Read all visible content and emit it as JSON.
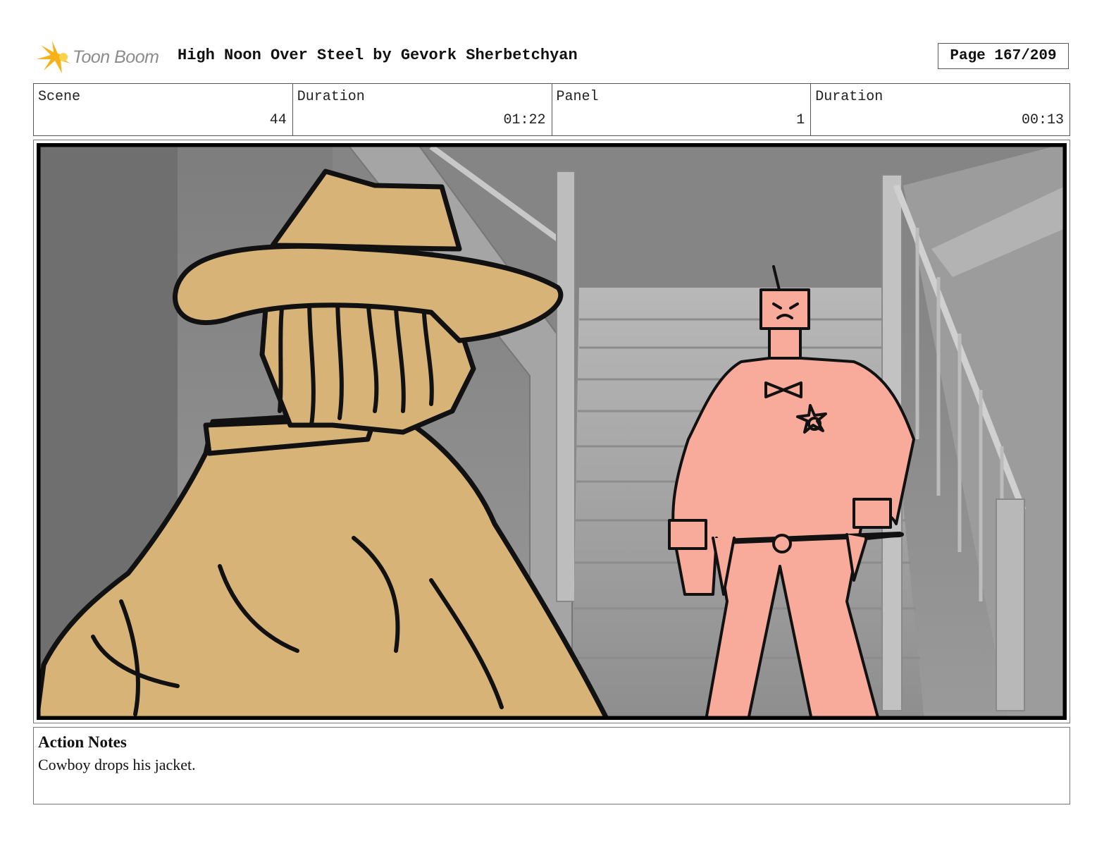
{
  "header": {
    "logo_text": "Toon Boom",
    "title": "High Noon Over Steel by Gevork Sherbetchyan",
    "page": "Page 167/209"
  },
  "info": {
    "scene_label": "Scene",
    "scene_value": "44",
    "scene_duration_label": "Duration",
    "scene_duration_value": "01:22",
    "panel_label": "Panel",
    "panel_value": "1",
    "panel_duration_label": "Duration",
    "panel_duration_value": "00:13"
  },
  "notes": {
    "title": "Action Notes",
    "text": "Cowboy drops his jacket."
  },
  "colors": {
    "cowboy_fill": "#d8b378",
    "robot_fill": "#f8aa9b",
    "background_gray": "#8a8a8a",
    "logo_orange": "#f6b21b",
    "logo_text": "#8c8c8c"
  }
}
